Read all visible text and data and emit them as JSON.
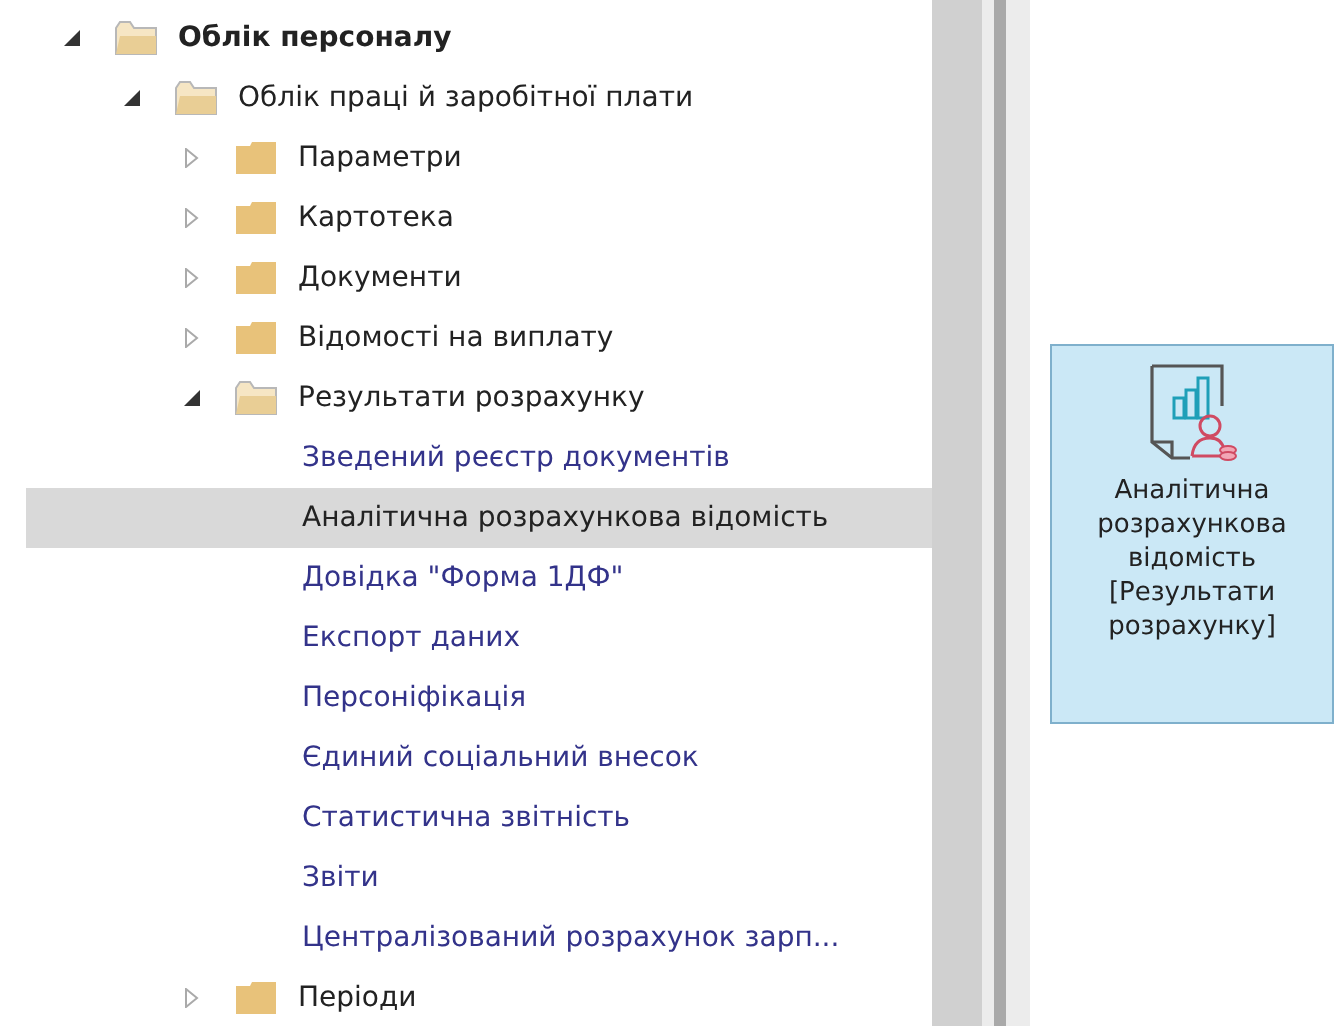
{
  "tree": [
    {
      "label": "Облік персоналу",
      "kind": "folder",
      "expanded": true,
      "selected": false,
      "children": [
        {
          "label": "Облік праці й заробітної плати",
          "kind": "folder",
          "expanded": true,
          "selected": false,
          "children": [
            {
              "label": "Параметри",
              "kind": "folder",
              "expanded": false,
              "selected": false
            },
            {
              "label": "Картотека",
              "kind": "folder",
              "expanded": false,
              "selected": false
            },
            {
              "label": "Документи",
              "kind": "folder",
              "expanded": false,
              "selected": false
            },
            {
              "label": "Відомості на виплату",
              "kind": "folder",
              "expanded": false,
              "selected": false
            },
            {
              "label": "Результати розрахунку",
              "kind": "folder",
              "expanded": true,
              "selected": false,
              "children": [
                {
                  "label": "Зведений реєстр документів",
                  "kind": "report",
                  "selected": false
                },
                {
                  "label": "Аналітична розрахункова відомість",
                  "kind": "report",
                  "selected": true
                },
                {
                  "label": "Довідка \"Форма 1ДФ\"",
                  "kind": "report",
                  "selected": false
                },
                {
                  "label": "Експорт даних",
                  "kind": "report",
                  "selected": false
                },
                {
                  "label": "Персоніфікація",
                  "kind": "report",
                  "selected": false
                },
                {
                  "label": "Єдиний соціальний внесок",
                  "kind": "report",
                  "selected": false
                },
                {
                  "label": "Статистична звітність",
                  "kind": "report",
                  "selected": false
                },
                {
                  "label": "Звіти",
                  "kind": "report",
                  "selected": false
                },
                {
                  "label": "Централізований розрахунок зарп...",
                  "kind": "report",
                  "selected": false
                }
              ]
            },
            {
              "label": "Періоди",
              "kind": "folder",
              "expanded": false,
              "selected": false
            }
          ]
        }
      ]
    }
  ],
  "tile": {
    "label": "Аналітична розрахункова відомість [Результати розрахунку]",
    "selected": true
  }
}
